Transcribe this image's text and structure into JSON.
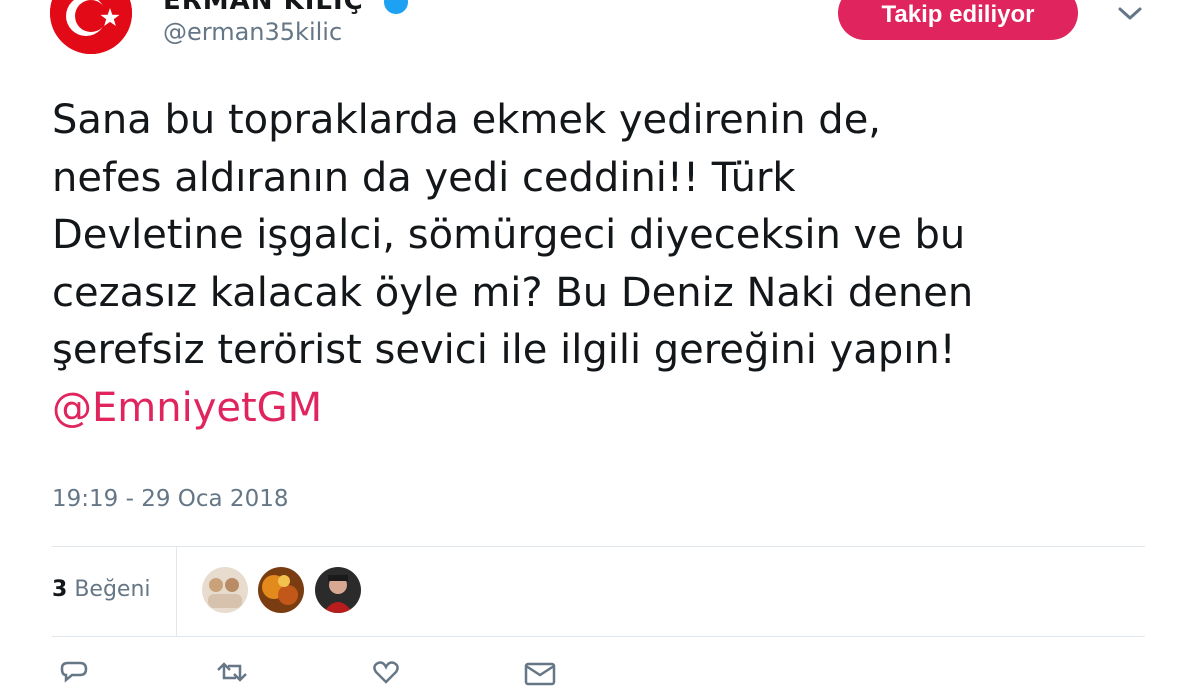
{
  "author": {
    "display_name": "ERMAN KILIÇ",
    "handle": "@erman35kilic"
  },
  "header": {
    "follow_label": "Takip ediliyor"
  },
  "tweet": {
    "lines": [
      "Sana bu topraklarda ekmek yedirenin de,",
      "nefes aldıranın da yedi ceddini!! Türk",
      "Devletine işgalci, sömürgeci diyeceksin ve bu",
      "cezasız kalacak öyle mi? Bu Deniz Naki denen",
      "şerefsiz terörist sevici ile ilgili gereğini yapın!"
    ],
    "mention": "@EmniyetGM",
    "timestamp": "19:19 - 29 Oca 2018"
  },
  "stats": {
    "like_count": "3",
    "like_label": "Beğeni"
  },
  "colors": {
    "accent": "#e0245e",
    "text": "#14171a",
    "muted": "#657786",
    "divider": "#e1e8ed",
    "flag_red": "#e30a17"
  },
  "icons": [
    "turkish-flag-avatar",
    "verified-icon",
    "chevron-down-icon",
    "reply-icon",
    "retweet-icon",
    "like-icon",
    "message-icon"
  ]
}
